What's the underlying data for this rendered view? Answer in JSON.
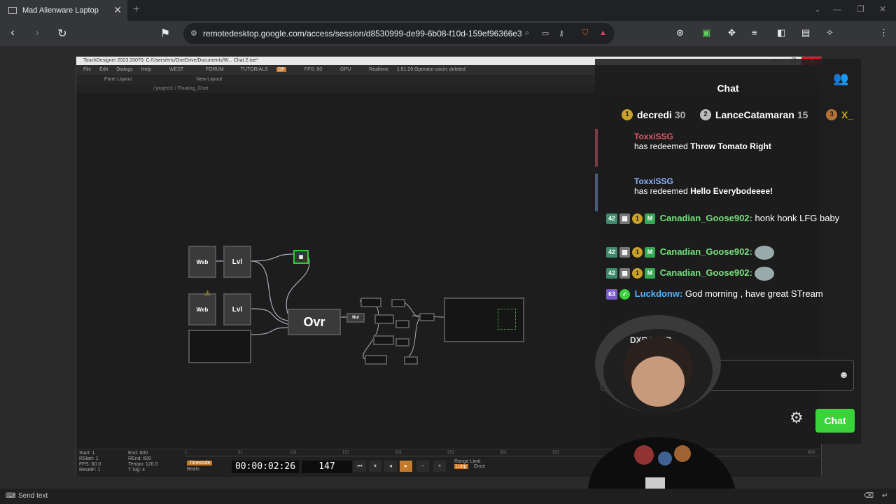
{
  "browser": {
    "tab_title": "Mad Alienware Laptop",
    "url": "remotedesktop.google.com/access/session/d8530999-de99-6b08-f10d-159ef96366e3"
  },
  "td": {
    "title": "TouchDesigner 2023.33070: C:/Users/eric/OneDrive/Documents/W... Chat 2.toe*",
    "menu": [
      "File",
      "Edit",
      "Dialogs",
      "Help",
      "WEST",
      "FORUM",
      "TUTORIALS",
      "OP",
      "FPS: 60",
      "GPU",
      "Realtime",
      "1:51:29 Operator oscin: deleted"
    ],
    "tools": [
      "Pane Layout",
      "New Layout"
    ],
    "path": "/ project1 / Floating_Chat",
    "nodes": {
      "web1": "Web",
      "lvl1": "Lvl",
      "web2": "Web",
      "lvl2": "Lvl",
      "ovr": "Ovr",
      "nul": "Nul"
    },
    "timeline": {
      "info": [
        "Start: 1",
        "RStart: 1",
        "FPS: 60.0",
        "ResetF: 1"
      ],
      "info2": [
        "End: 600",
        "REnd: 600",
        "Tempo: 120.0",
        "T Sig: 4"
      ],
      "ruler": [
        "1",
        "51",
        "101",
        "151",
        "201",
        "251",
        "301",
        "351",
        "600"
      ],
      "timecode_label": "Timecode",
      "beats_label": "Beats",
      "timecode": "00:00:02:26",
      "frame": "147",
      "range_label": "Range Limit",
      "loop_label": "Loop",
      "once_label": "Once"
    }
  },
  "chat": {
    "title": "Chat",
    "leaders": [
      {
        "rank": "1",
        "name": "decredi",
        "score": "30"
      },
      {
        "rank": "2",
        "name": "LanceCatamaran",
        "score": "15"
      },
      {
        "rank": "3",
        "name": "X_",
        "score": ""
      }
    ],
    "redeems": [
      {
        "user": "ToxxiSSG",
        "text": "has redeemed",
        "reward": "Throw Tomato Right"
      },
      {
        "user": "ToxxiSSG",
        "text": "has redeemed",
        "reward": "Hello Everybodeeee!"
      }
    ],
    "messages": [
      {
        "months": "42",
        "user": "Canadian_Goose902:",
        "text": "honk honk LFG baby",
        "color": "#74e07a"
      },
      {
        "months": "42",
        "user": "Canadian_Goose902:",
        "text": "",
        "color": "#74e07a"
      },
      {
        "months": "42",
        "user": "Canadian_Goose902:",
        "text": "",
        "color": "#74e07a"
      },
      {
        "months": "63",
        "user": "Luckdonw:",
        "text": "God morning , have great STream",
        "color": "#4fb6ff"
      }
    ],
    "send_label": "Chat"
  },
  "bottom": {
    "send_text": "Send text"
  }
}
